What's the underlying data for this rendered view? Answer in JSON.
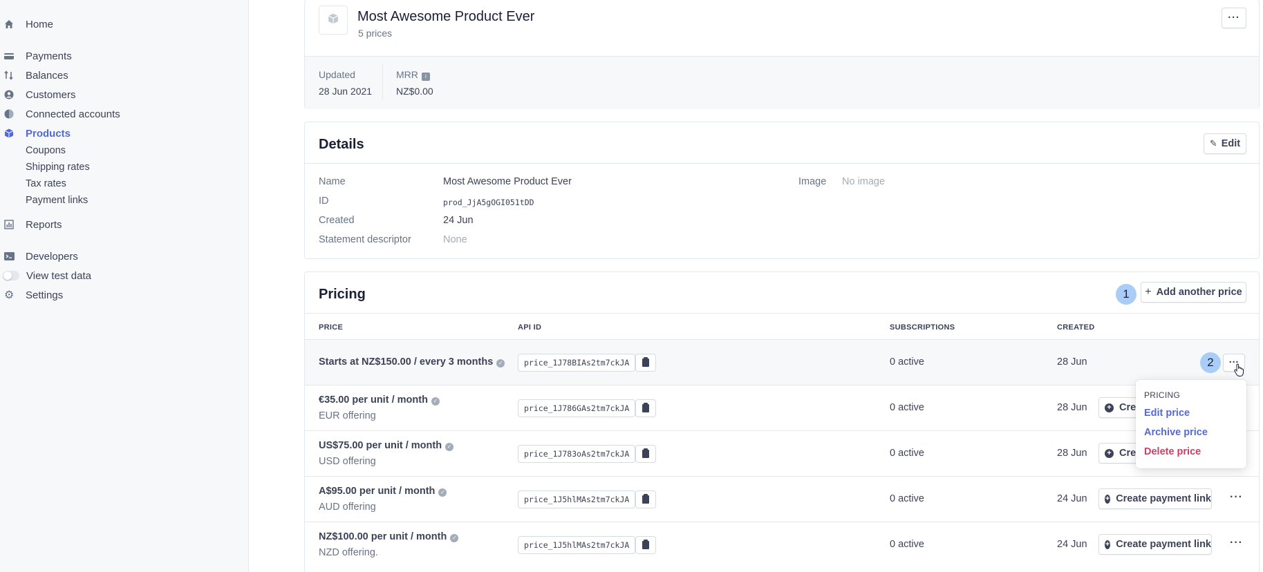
{
  "sidebar": {
    "home": "Home",
    "payments": "Payments",
    "balances": "Balances",
    "customers": "Customers",
    "connected": "Connected accounts",
    "products": "Products",
    "coupons": "Coupons",
    "shipping": "Shipping rates",
    "tax": "Tax rates",
    "payment_links": "Payment links",
    "reports": "Reports",
    "developers": "Developers",
    "test_data": "View test data",
    "settings": "Settings"
  },
  "product": {
    "name": "Most Awesome Product Ever",
    "prices_count": "5 prices",
    "updated_label": "Updated",
    "updated_value": "28 Jun 2021",
    "mrr_label": "MRR",
    "mrr_value": "NZ$0.00"
  },
  "details": {
    "title": "Details",
    "edit": "Edit",
    "name_label": "Name",
    "name_value": "Most Awesome Product Ever",
    "id_label": "ID",
    "id_value": "prod_JjA5gOGI051tDD",
    "created_label": "Created",
    "created_value": "24 Jun",
    "descriptor_label": "Statement descriptor",
    "descriptor_value": "None",
    "image_label": "Image",
    "image_value": "No image"
  },
  "pricing": {
    "title": "Pricing",
    "add_price": "Add another price",
    "badge1": "1",
    "badge2": "2",
    "headers": {
      "price": "PRICE",
      "api_id": "API ID",
      "subscriptions": "SUBSCRIPTIONS",
      "created": "CREATED"
    },
    "create_link": "Create payment link",
    "create_link_partial": "Crea",
    "rows": [
      {
        "title": "Starts at NZ$150.00 / every 3 months",
        "sub": "",
        "api_id": "price_1J78BIAs2tm7ckJA",
        "subs": "0 active",
        "created": "28 Jun"
      },
      {
        "title": "€35.00 per unit / month",
        "sub": "EUR offering",
        "api_id": "price_1J786GAs2tm7ckJA",
        "subs": "0 active",
        "created": "28 Jun"
      },
      {
        "title": "US$75.00 per unit / month",
        "sub": "USD offering",
        "api_id": "price_1J783oAs2tm7ckJA",
        "subs": "0 active",
        "created": "28 Jun"
      },
      {
        "title": "A$95.00 per unit / month",
        "sub": "AUD offering",
        "api_id": "price_1J5hlMAs2tm7ckJA",
        "subs": "0 active",
        "created": "24 Jun"
      },
      {
        "title": "NZ$100.00 per unit / month",
        "sub": "NZD offering.",
        "api_id": "price_1J5hlMAs2tm7ckJA",
        "subs": "0 active",
        "created": "24 Jun"
      }
    ]
  },
  "menu": {
    "header": "PRICING",
    "edit": "Edit price",
    "archive": "Archive price",
    "delete": "Delete price"
  },
  "colors": {
    "accent": "#5469d4",
    "danger": "#cd3d64",
    "badge": "#a9cdf7"
  }
}
